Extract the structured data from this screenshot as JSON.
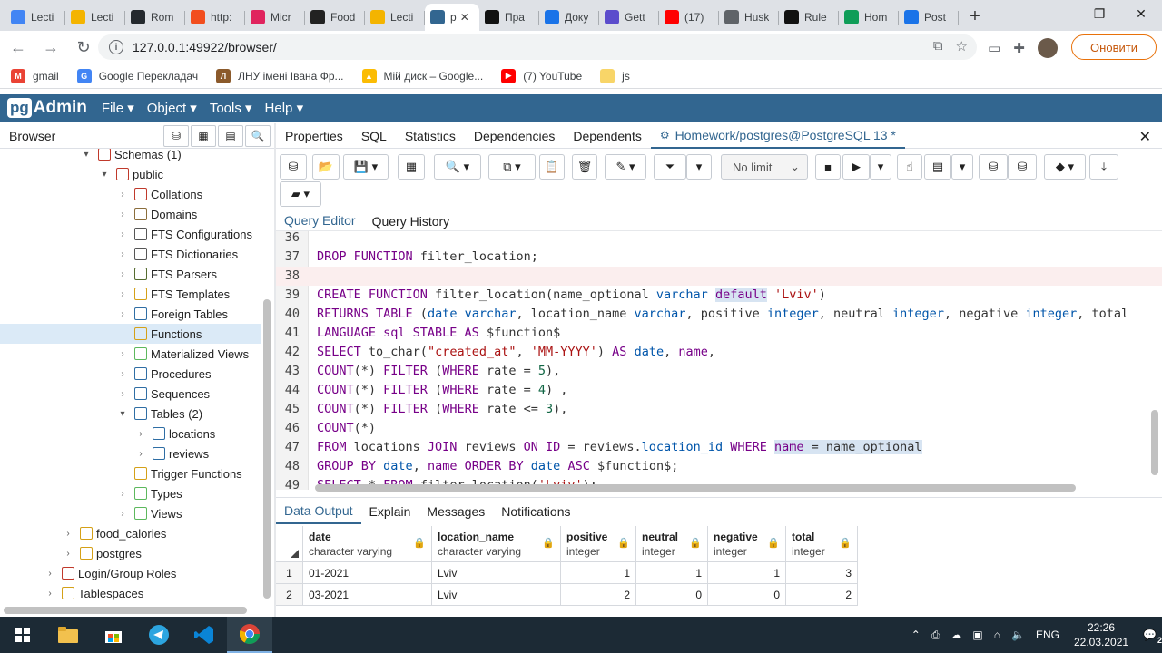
{
  "browser_tabs": [
    {
      "title": "Lecti",
      "icon": "doc-icon",
      "color": "#4285f4"
    },
    {
      "title": "Lecti",
      "icon": "slides-icon",
      "color": "#f4b400"
    },
    {
      "title": "Rom",
      "icon": "github-icon",
      "color": "#24292e"
    },
    {
      "title": "http:",
      "icon": "figma-icon",
      "color": "#f24e1e"
    },
    {
      "title": "Micr",
      "icon": "ms-icon",
      "color": "#e0245e"
    },
    {
      "title": "Food",
      "icon": "trello-icon",
      "color": "#222222"
    },
    {
      "title": "Lecti",
      "icon": "slides-icon",
      "color": "#f4b400"
    },
    {
      "title": "p",
      "icon": "pgadmin-icon",
      "color": "#326690",
      "active": true
    },
    {
      "title": "Пра",
      "icon": "ch-icon",
      "color": "#111111"
    },
    {
      "title": "Доку",
      "icon": "doc-icon",
      "color": "#1a73e8"
    },
    {
      "title": "Gett",
      "icon": "circle-icon",
      "color": "#5b4ccc"
    },
    {
      "title": "(17)",
      "icon": "youtube-icon",
      "color": "#ff0000"
    },
    {
      "title": "Husk",
      "icon": "globe-icon",
      "color": "#5f6368"
    },
    {
      "title": "Rule",
      "icon": "o-icon",
      "color": "#111111"
    },
    {
      "title": "Hom",
      "icon": "sheets-icon",
      "color": "#0f9d58"
    },
    {
      "title": "Post",
      "icon": "doc-icon",
      "color": "#1a73e8"
    }
  ],
  "address": {
    "url": "127.0.0.1:49922/browser/",
    "update_label": "Оновити"
  },
  "bookmarks": [
    {
      "label": "gmail",
      "color": "#ea4335",
      "glyph": "M"
    },
    {
      "label": "Google Перекладач",
      "color": "#4285f4",
      "glyph": "G"
    },
    {
      "label": "ЛНУ імені Івана Фр...",
      "color": "#8b5a2b",
      "glyph": "Л"
    },
    {
      "label": "Мій диск – Google...",
      "color": "#fbbc04",
      "glyph": "▲"
    },
    {
      "label": "(7) YouTube",
      "color": "#ff0000",
      "glyph": "▶"
    },
    {
      "label": "js",
      "color": "#f8d568",
      "glyph": ""
    }
  ],
  "app": {
    "logo_pg": "pg",
    "logo_admin": "Admin",
    "menus": [
      "File ▾",
      "Object ▾",
      "Tools ▾",
      "Help ▾"
    ]
  },
  "browser_panel": {
    "title": "Browser",
    "tree": [
      {
        "label": "Schemas (1)",
        "depth": 4,
        "exp": "▾",
        "icon": "schemas-icon",
        "color": "#c0392b"
      },
      {
        "label": "public",
        "depth": 5,
        "exp": "▾",
        "icon": "schema-icon",
        "color": "#c0392b"
      },
      {
        "label": "Collations",
        "depth": 6,
        "exp": "›",
        "icon": "collation-icon",
        "color": "#c0392b"
      },
      {
        "label": "Domains",
        "depth": 6,
        "exp": "›",
        "icon": "domain-icon",
        "color": "#8a6d3b"
      },
      {
        "label": "FTS Configurations",
        "depth": 6,
        "exp": "›",
        "icon": "fts-config-icon",
        "color": "#555555"
      },
      {
        "label": "FTS Dictionaries",
        "depth": 6,
        "exp": "›",
        "icon": "fts-dict-icon",
        "color": "#555555"
      },
      {
        "label": "FTS Parsers",
        "depth": 6,
        "exp": "›",
        "icon": "fts-parser-icon",
        "color": "#556b2f"
      },
      {
        "label": "FTS Templates",
        "depth": 6,
        "exp": "›",
        "icon": "fts-template-icon",
        "color": "#d4a017"
      },
      {
        "label": "Foreign Tables",
        "depth": 6,
        "exp": "›",
        "icon": "foreign-table-icon",
        "color": "#2e6da4"
      },
      {
        "label": "Functions",
        "depth": 6,
        "exp": "",
        "icon": "function-icon",
        "color": "#d4a017",
        "selected": true
      },
      {
        "label": "Materialized Views",
        "depth": 6,
        "exp": "›",
        "icon": "matview-icon",
        "color": "#5cb85c"
      },
      {
        "label": "Procedures",
        "depth": 6,
        "exp": "›",
        "icon": "procedure-icon",
        "color": "#2e6da4"
      },
      {
        "label": "Sequences",
        "depth": 6,
        "exp": "›",
        "icon": "sequence-icon",
        "color": "#2e6da4"
      },
      {
        "label": "Tables (2)",
        "depth": 6,
        "exp": "▾",
        "icon": "tables-icon",
        "color": "#2e6da4"
      },
      {
        "label": "locations",
        "depth": 7,
        "exp": "›",
        "icon": "table-icon",
        "color": "#2e6da4"
      },
      {
        "label": "reviews",
        "depth": 7,
        "exp": "›",
        "icon": "table-icon",
        "color": "#2e6da4"
      },
      {
        "label": "Trigger Functions",
        "depth": 6,
        "exp": "",
        "icon": "trigger-function-icon",
        "color": "#d4a017"
      },
      {
        "label": "Types",
        "depth": 6,
        "exp": "›",
        "icon": "type-icon",
        "color": "#5cb85c"
      },
      {
        "label": "Views",
        "depth": 6,
        "exp": "›",
        "icon": "view-icon",
        "color": "#5cb85c"
      },
      {
        "label": "food_calories",
        "depth": 3,
        "exp": "›",
        "icon": "database-icon",
        "color": "#d4a017"
      },
      {
        "label": "postgres",
        "depth": 3,
        "exp": "›",
        "icon": "database-icon",
        "color": "#d4a017"
      },
      {
        "label": "Login/Group Roles",
        "depth": 2,
        "exp": "›",
        "icon": "roles-icon",
        "color": "#c0392b"
      },
      {
        "label": "Tablespaces",
        "depth": 2,
        "exp": "›",
        "icon": "tablespace-icon",
        "color": "#d4a017"
      }
    ]
  },
  "main_tabs": [
    "Properties",
    "SQL",
    "Statistics",
    "Dependencies",
    "Dependents"
  ],
  "query_tab": "Homework/postgres@PostgreSQL 13 *",
  "toolbar": {
    "limit": "No limit"
  },
  "editor_tabs": [
    "Query Editor",
    "Query History"
  ],
  "editor_lines": [
    {
      "n": "36",
      "html": ""
    },
    {
      "n": "37",
      "html": "<span class=\"kw\">DROP FUNCTION</span> filter_location;"
    },
    {
      "n": "38",
      "html": "",
      "highlight": true
    },
    {
      "n": "39",
      "html": "<span class=\"kw\">CREATE FUNCTION</span> filter_location(name_optional <span class=\"ty\">varchar</span> <span class=\"kw sel-w\">default</span> <span class=\"str\">'Lviv'</span>)"
    },
    {
      "n": "40",
      "html": "<span class=\"kw\">RETURNS TABLE</span> (<span class=\"ty\">date</span> <span class=\"ty\">varchar</span>, location_name <span class=\"ty\">varchar</span>, positive <span class=\"ty\">integer</span>, neutral <span class=\"ty\">integer</span>, negative <span class=\"ty\">integer</span>, total"
    },
    {
      "n": "41",
      "html": "<span class=\"kw\">LANGUAGE sql STABLE AS</span> $function$"
    },
    {
      "n": "42",
      "html": "<span class=\"kw\">SELECT</span> to_char(<span class=\"str\">\"created_at\"</span>, <span class=\"str\">'MM-YYYY'</span>) <span class=\"kw\">AS</span> <span class=\"ty\">date</span>, <span class=\"kw\">name</span>,"
    },
    {
      "n": "43",
      "html": "<span class=\"kw\">COUNT</span>(*) <span class=\"kw\">FILTER</span> (<span class=\"kw\">WHERE</span> rate = <span class=\"num\">5</span>),"
    },
    {
      "n": "44",
      "html": "<span class=\"kw\">COUNT</span>(*) <span class=\"kw\">FILTER</span> (<span class=\"kw\">WHERE</span> rate = <span class=\"num\">4</span>) ,"
    },
    {
      "n": "45",
      "html": "<span class=\"kw\">COUNT</span>(*) <span class=\"kw\">FILTER</span> (<span class=\"kw\">WHERE</span> rate &lt;= <span class=\"num\">3</span>),"
    },
    {
      "n": "46",
      "html": "<span class=\"kw\">COUNT</span>(*)"
    },
    {
      "n": "47",
      "html": "<span class=\"kw\">FROM</span> locations <span class=\"kw\">JOIN</span> reviews <span class=\"kw\">ON</span> <span class=\"kw\">ID</span> = reviews.<span class=\"ty\">location_id</span> <span class=\"kw\">WHERE</span> <span class=\"kw sel-w\">name</span><span class=\"sel-w\"> = name_optional</span>"
    },
    {
      "n": "48",
      "html": "<span class=\"kw\">GROUP BY</span> <span class=\"ty\">date</span>, <span class=\"kw\">name</span> <span class=\"kw\">ORDER BY</span> <span class=\"ty\">date</span> <span class=\"kw\">ASC</span> $function$;"
    },
    {
      "n": "49",
      "html": "<span class=\"kw\">SELECT</span> * <span class=\"kw\">FROM</span> filter_location(<span class=\"str\">'Lviv'</span>);"
    }
  ],
  "output_tabs": [
    "Data Output",
    "Explain",
    "Messages",
    "Notifications"
  ],
  "results": {
    "columns": [
      {
        "name": "date",
        "type": "character varying"
      },
      {
        "name": "location_name",
        "type": "character varying"
      },
      {
        "name": "positive",
        "type": "integer"
      },
      {
        "name": "neutral",
        "type": "integer"
      },
      {
        "name": "negative",
        "type": "integer"
      },
      {
        "name": "total",
        "type": "integer"
      }
    ],
    "rows": [
      {
        "n": "1",
        "cells": [
          "01-2021",
          "Lviv",
          "1",
          "1",
          "1",
          "3"
        ]
      },
      {
        "n": "2",
        "cells": [
          "03-2021",
          "Lviv",
          "2",
          "0",
          "0",
          "2"
        ]
      }
    ]
  },
  "taskbar": {
    "lang": "ENG",
    "time": "22:26",
    "date": "22.03.2021",
    "notif": "2"
  }
}
